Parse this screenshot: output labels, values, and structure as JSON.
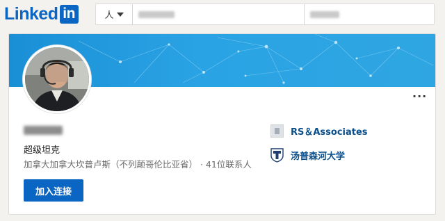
{
  "header": {
    "logo_text": "Linked",
    "logo_box_text": "in",
    "search_scope_label": "人"
  },
  "profile": {
    "headline": "超级坦克",
    "location": "加拿大加拿大坎普卢斯（不列颠哥伦比亚省） · 41位联系人",
    "connect_label": "加入连接",
    "more_label": "···",
    "current_company": "RS＆Associates",
    "education": "汤普森河大学"
  },
  "colors": {
    "brand": "#0a66c2",
    "banner": "#2aa3e4",
    "link": "#0a4f8c"
  },
  "icons": {
    "scope_caret": "chevron-down-icon",
    "company_logo": "building-icon",
    "school_logo": "shield-icon"
  }
}
